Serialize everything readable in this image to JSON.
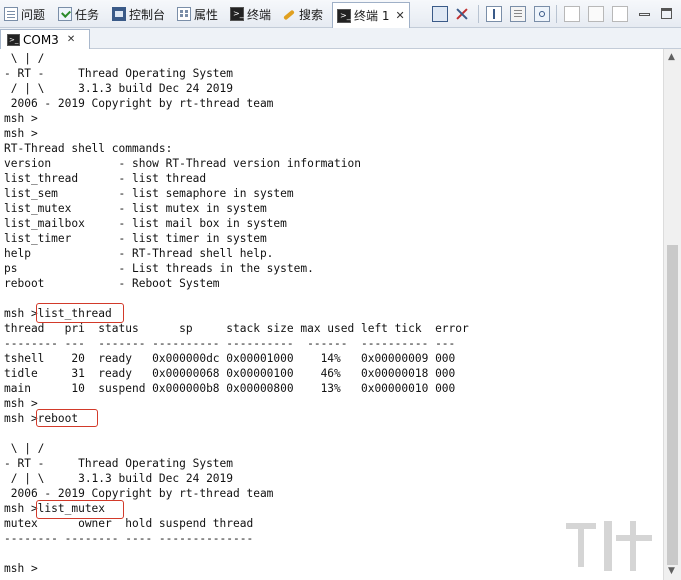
{
  "tabs": [
    {
      "label": "问题",
      "icon": "problems-icon"
    },
    {
      "label": "任务",
      "icon": "tasks-icon"
    },
    {
      "label": "控制台",
      "icon": "console-icon"
    },
    {
      "label": "属性",
      "icon": "properties-icon"
    },
    {
      "label": "终端",
      "icon": "terminal-icon"
    },
    {
      "label": "搜索",
      "icon": "search-icon"
    },
    {
      "label": "终端 1",
      "icon": "terminal-icon"
    }
  ],
  "console_tab": {
    "label": "COM3"
  },
  "console_lines": [
    " \\ | /",
    "- RT -     Thread Operating System",
    " / | \\     3.1.3 build Dec 24 2019",
    " 2006 - 2019 Copyright by rt-thread team",
    "msh >",
    "msh >",
    "RT-Thread shell commands:",
    "version          - show RT-Thread version information",
    "list_thread      - list thread",
    "list_sem         - list semaphore in system",
    "list_mutex       - list mutex in system",
    "list_mailbox     - list mail box in system",
    "list_timer       - list timer in system",
    "help             - RT-Thread shell help.",
    "ps               - List threads in the system.",
    "reboot           - Reboot System",
    "",
    "msh >list_thread",
    "thread   pri  status      sp     stack size max used left tick  error",
    "-------- ---  ------- ---------- ----------  ------  ---------- ---",
    "tshell    20  ready   0x000000dc 0x00001000    14%   0x00000009 000",
    "tidle     31  ready   0x00000068 0x00000100    46%   0x00000018 000",
    "main      10  suspend 0x000000b8 0x00000800    13%   0x00000010 000",
    "msh >",
    "msh >reboot",
    "",
    " \\ | /",
    "- RT -     Thread Operating System",
    " / | \\     3.1.3 build Dec 24 2019",
    " 2006 - 2019 Copyright by rt-thread team",
    "msh >list_mutex",
    "mutex      owner  hold suspend thread",
    "-------- -------- ---- --------------",
    "",
    "msh >"
  ],
  "colors": {
    "highlight": "#d23a2a",
    "accent": "#1f5fa8"
  }
}
